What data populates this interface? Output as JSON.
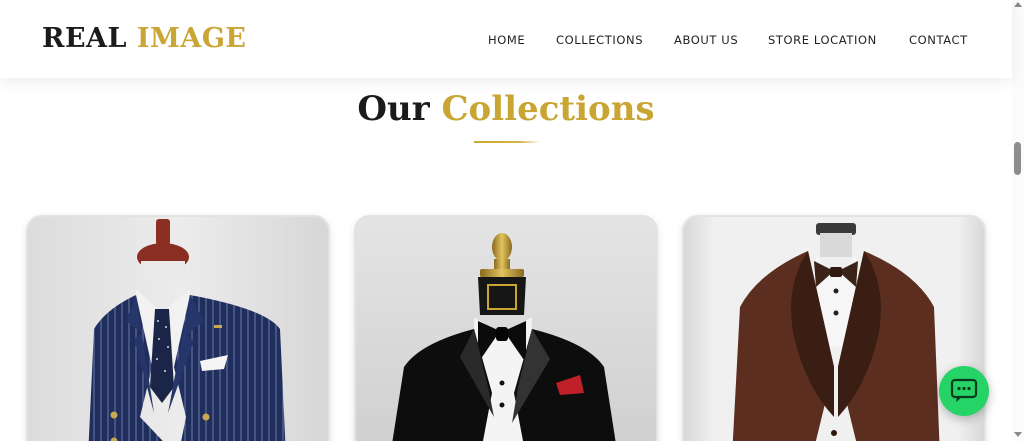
{
  "brand": {
    "name_first": "REAL",
    "name_second": "IMAGE"
  },
  "nav": {
    "items": [
      {
        "label": "HOME"
      },
      {
        "label": "COLLECTIONS"
      },
      {
        "label": "ABOUT US"
      },
      {
        "label": "STORE LOCATION"
      },
      {
        "label": "CONTACT"
      }
    ]
  },
  "section": {
    "title_first": "Our",
    "title_second": "Collections"
  },
  "collections": [
    {
      "image": "navy-pinstripe-double-breasted-suit"
    },
    {
      "image": "black-tuxedo-bow-tie"
    },
    {
      "image": "brown-shawl-lapel-tuxedo"
    }
  ],
  "chat": {
    "icon": "chat-bubble-icon"
  },
  "colors": {
    "accent_gold": "#c9a534",
    "text_dark": "#1b1b1b",
    "chat_green": "#25d366"
  }
}
